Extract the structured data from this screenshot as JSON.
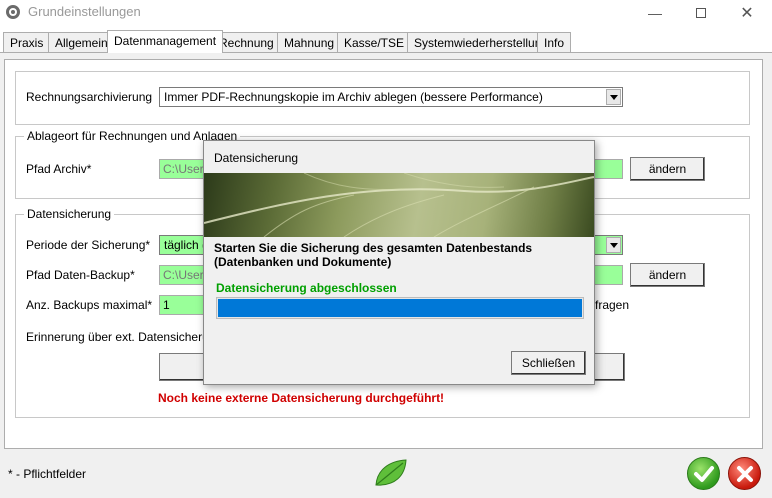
{
  "window": {
    "title": "Grundeinstellungen"
  },
  "tabs": [
    "Praxis",
    "Allgemein",
    "Datenmanagement",
    "Rechnung",
    "Mahnung",
    "Kasse/TSE",
    "Systemwiederherstellung",
    "Info"
  ],
  "archiv": {
    "label": "Rechnungsarchivierung",
    "value": "Immer PDF-Rechnungskopie im Archiv ablegen (bessere Performance)"
  },
  "ablage": {
    "legend": "Ablageort für Rechnungen und Anlagen",
    "pfad_label": "Pfad Archiv*",
    "pfad_value": "C:\\Users",
    "change_label": "ändern"
  },
  "sicherung": {
    "legend": "Datensicherung",
    "periode_label": "Periode der Sicherung*",
    "periode_value": "täglich (e",
    "pfad_label": "Pfad Daten-Backup*",
    "pfad_value": "C:\\Users",
    "change_label": "ändern",
    "anz_label": "Anz. Backups maximal*",
    "anz_value": "1",
    "fragen_text": "fragen",
    "erinnerung_label": "Erinnerung über ext. Datensicherung",
    "warn_text": "Noch keine externe Datensicherung durchgeführt!"
  },
  "footer": {
    "note": "* - Pflichtfelder"
  },
  "dialog": {
    "title": "Datensicherung",
    "heading": "Starten Sie die Sicherung des gesamten Datenbestands (Datenbanken und Dokumente)",
    "status": "Datensicherung abgeschlossen",
    "progress": 1.0,
    "close_label": "Schließen"
  },
  "colors": {
    "accent": "#0078d7",
    "required_field": "#99ff99",
    "warning": "#d00000",
    "success": "#00a000"
  }
}
